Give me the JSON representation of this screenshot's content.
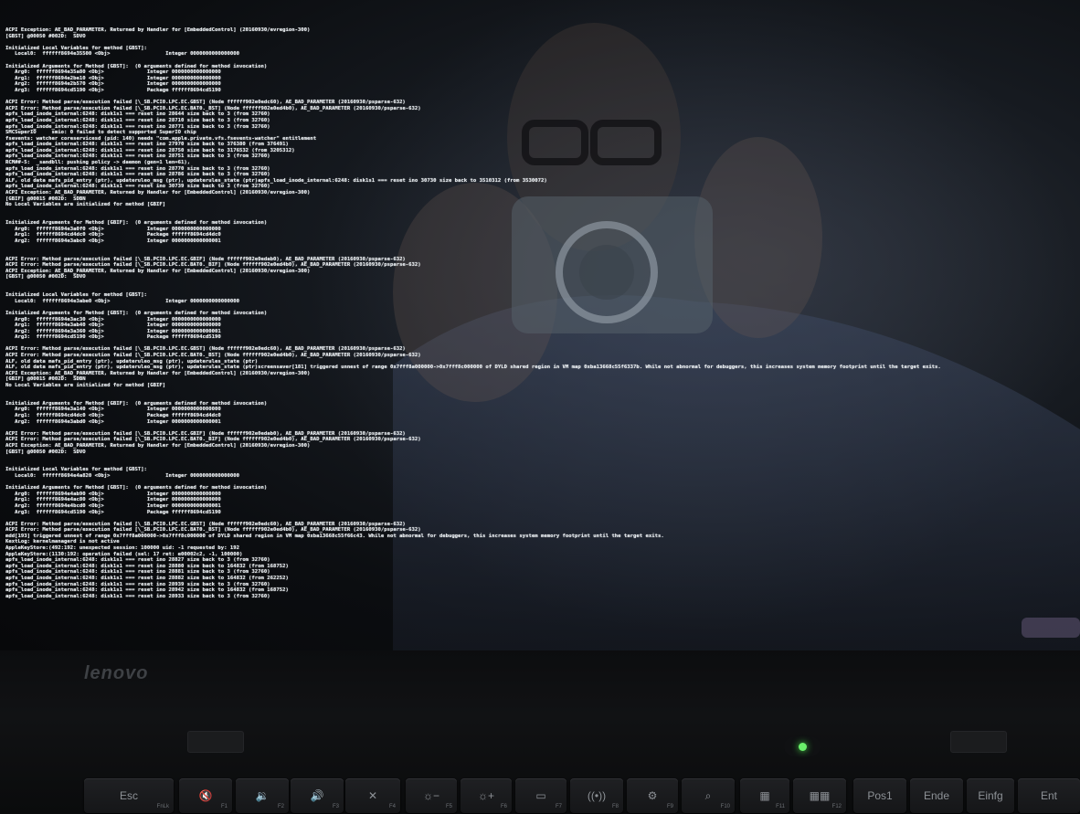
{
  "console": {
    "lines": [
      "ACPI Exception: AE_BAD_PARAMETER, Returned by Handler for [EmbeddedControl] (20160930/evregion-300)",
      "[GBST] @00050 #002D:  SDVO",
      "",
      "Initialized Local Variables for method [GBST]:",
      "   Local0:  ffffff8694e35500 <Obj>                  Integer 0000000000000000",
      "",
      "Initialized Arguments for Method [GBST]:  (0 arguments defined for method invocation)",
      "   Arg0:  ffffff8694e35a80 <Obj>              Integer 0000000000000000",
      "   Arg1:  ffffff8694e2be10 <Obj>              Integer 0000000000000000",
      "   Arg2:  ffffff8694e2b570 <Obj>              Integer 0000000000000000",
      "   Arg3:  ffffff8694cd5190 <Obj>              Package ffffff8694cd5190",
      "",
      "ACPI Error: Method parse/execution failed [\\_SB.PCI0.LPC.EC.GBST] (Node ffffff902e0edc60), AE_BAD_PARAMETER (20160930/psparse-632)",
      "ACPI Error: Method parse/execution failed [\\_SB.PCI0.LPC.EC.BAT0._BST] (Node ffffff902e0ed4b0), AE_BAD_PARAMETER (20160930/psparse-632)",
      "apfs_load_inode_internal:6248: disk1s1 === reset ino 28644 size back to 3 (from 32760)",
      "apfs_load_inode_internal:6248: disk1s1 === reset ino 28710 size back to 3 (from 32760)",
      "apfs_load_inode_internal:6248: disk1s1 === reset ino 28771 size back to 3 (from 32760)",
      "SMCSuperIO     smio: 0 failed to detect supported SuperIO chip",
      "fsevents: watcher coreservicesd (pid: 140) needs \"com.apple.private.vfs.fsevents-watcher\" entitlement",
      "apfs_load_inode_internal:6248: disk1s1 === reset ino 27970 size back to 376380 (from 376491)",
      "apfs_load_inode_internal:6248: disk1s1 === reset ino 28750 size back to 3176532 (from 3205312)",
      "apfs_load_inode_internal:6248: disk1s1 === reset ino 28751 size back to 3 (from 32760)",
      "RCM##-5:  _sandbll: pushing policy -> daemon (gen=1 len=61),",
      "apfs_load_inode_internal:6248: disk1s1 === reset ino 28770 size back to 3 (from 32760)",
      "apfs_load_inode_internal:6248: disk1s1 === reset ino 28786 size back to 3 (from 32760)",
      "ALF, old data mafs_pid_entry (ptr), updateruleo_msg (ptr), updaterules_state (ptr)apfs_load_inode_internal:6248: disk1s1 === reset ino 30730 size back to 3510312 (from 3530072)",
      "apfs_load_inode_internal:6248: disk1s1 === reset ino 30739 size back to 3 (from 32760)",
      "ACPI Exception: AE_BAD_PARAMETER, Returned by Handler for [EmbeddedControl] (20160930/evregion-300)",
      "[GBIF] @00015 #002D:  SDBN",
      "No Local Variables are initialized for method [GBIF]",
      "",
      "",
      "Initialized Arguments for Method [GBIF]:  (0 arguments defined for method invocation)",
      "   Arg0:  ffffff8694e3a0f0 <Obj>              Integer 0000000000000000",
      "   Arg1:  ffffff8694cd4dc0 <Obj>              Package ffffff8694cd4dc0",
      "   Arg2:  ffffff8694e3abc0 <Obj>              Integer 0000000000000001",
      "",
      "",
      "ACPI Error: Method parse/execution failed [\\_SB.PCI0.LPC.EC.GBIF] (Node ffffff902e0edab0), AE_BAD_PARAMETER (20160930/psparse-632)",
      "ACPI Error: Method parse/execution failed [\\_SB.PCI0.LPC.EC.BAT0._BIF] (Node ffffff902e0ed4b0), AE_BAD_PARAMETER (20160930/psparse-632)",
      "ACPI Exception: AE_BAD_PARAMETER, Returned by Handler for [EmbeddedControl] (20160930/evregion-300)",
      "[GBST] @00050 #002D:  SDVO",
      "",
      "",
      "Initialized Local Variables for method [GBST]:",
      "   Local0:  ffffff8694e3abe0 <Obj>                  Integer 0000000000000000",
      "",
      "Initialized Arguments for Method [GBST]:  (0 arguments defined for method invocation)",
      "   Arg0:  ffffff8694e3ac30 <Obj>              Integer 0000000000000000",
      "   Arg1:  ffffff8694e3ab40 <Obj>              Integer 0000000000000000",
      "   Arg2:  ffffff8694e3a360 <Obj>              Integer 0000000000000001",
      "   Arg3:  ffffff8694cd5190 <Obj>              Package ffffff8694cd5190",
      "",
      "ACPI Error: Method parse/execution failed [\\_SB.PCI0.LPC.EC.GBST] (Node ffffff902e0edc60), AE_BAD_PARAMETER (20160930/psparse-632)",
      "ACPI Error: Method parse/execution failed [\\_SB.PCI0.LPC.EC.BAT0._BST] (Node ffffff902e0ed4b0), AE_BAD_PARAMETER (20160930/psparse-632)",
      "ALF, old data mafs_pid_entry (ptr), updateruleo_msg (ptr), updaterules_state (ptr)",
      "ALF, old data mafs_pid_entry (ptr), updateruleo_msg (ptr), updaterules_state (ptr)screensaver[181] triggered unnest of range 0x7fff8a000000->0x7fff8c000000 of DYLD shared region in VM map 0xba13668c55f6337b. While not abnormal for debuggers, this increases system memory footprint until the target exits.",
      "ACPI Exception: AE_BAD_PARAMETER, Returned by Handler for [EmbeddedControl] (20160930/evregion-300)",
      "[GBIF] @00015 #002D:  SDBN",
      "No Local Variables are initialized for method [GBIF]",
      "",
      "",
      "Initialized Arguments for Method [GBIF]:  (0 arguments defined for method invocation)",
      "   Arg0:  ffffff8694e3a140 <Obj>              Integer 0000000000000000",
      "   Arg1:  ffffff8694cd4dc0 <Obj>              Package ffffff8694cd4dc0",
      "   Arg2:  ffffff8694e3abd0 <Obj>              Integer 0000000000000001",
      "",
      "ACPI Error: Method parse/execution failed [\\_SB.PCI0.LPC.EC.GBIF] (Node ffffff902e0edab0), AE_BAD_PARAMETER (20160930/psparse-632)",
      "ACPI Error: Method parse/execution failed [\\_SB.PCI0.LPC.EC.BAT0._BIF] (Node ffffff902e0ed4b0), AE_BAD_PARAMETER (20160930/psparse-632)",
      "ACPI Exception: AE_BAD_PARAMETER, Returned by Handler for [EmbeddedControl] (20160930/evregion-300)",
      "[GBST] @00050 #002D:  SDVO",
      "",
      "",
      "Initialized Local Variables for method [GBST]:",
      "   Local0:  ffffff8694e4a820 <Obj>                  Integer 0000000000000000",
      "",
      "Initialized Arguments for Method [GBST]:  (0 arguments defined for method invocation)",
      "   Arg0:  ffffff8694e4ab90 <Obj>              Integer 0000000000000000",
      "   Arg1:  ffffff8694e4ac80 <Obj>              Integer 0000000000000000",
      "   Arg2:  ffffff8694e4bcd0 <Obj>              Integer 0000000000000001",
      "   Arg3:  ffffff8694cd5190 <Obj>              Package ffffff8694cd5190",
      "",
      "ACPI Error: Method parse/execution failed [\\_SB.PCI0.LPC.EC.GBST] (Node ffffff902e0edc60), AE_BAD_PARAMETER (20160930/psparse-632)",
      "ACPI Error: Method parse/execution failed [\\_SB.PCI0.LPC.EC.BAT0._BST] (Node ffffff902e0ed4b0), AE_BAD_PARAMETER (20160930/psparse-632)",
      "mdd[193] triggered unnest of range 0x7fff8a000000->0x7fff8c000000 of DYLD shared region in VM map 0xba13668c55f66c43. While not abnormal for debuggers, this increases system memory footprint until the target exits.",
      "KextLog: kernelmanagerd is not active",
      "AppleKeyStore:(492:192: unexpected session: 100000 uid: -1 requested by: 192",
      "AppleKeyStore:(1130:192: operation failed (sel: 17 ret: e00002c2, -1, 100000)",
      "apfs_load_inode_internal:6248: disk1s1 === reset ino 28827 size back to 3 (from 32760)",
      "apfs_load_inode_internal:6248: disk1s1 === reset ino 28880 size back to 164832 (from 168752)",
      "apfs_load_inode_internal:6248: disk1s1 === reset ino 28881 size back to 3 (from 32760)",
      "apfs_load_inode_internal:6248: disk1s1 === reset ino 28882 size back to 164832 (from 262252)",
      "apfs_load_inode_internal:6248: disk1s1 === reset ino 28939 size back to 3 (from 32760)",
      "apfs_load_inode_internal:6248: disk1s1 === reset ino 28942 size back to 164832 (from 168752)",
      "apfs_load_inode_internal:6248: disk1s1 === reset ino 28933 size back to 3 (from 32760)"
    ]
  },
  "bezel": {
    "brand": "lenovo"
  },
  "keyboard": {
    "keys": [
      {
        "label": "Esc",
        "sub": "FnLk",
        "icon": "esc-key"
      },
      {
        "label": "🔇",
        "sub": "F1",
        "icon": "mute-icon"
      },
      {
        "label": "🔉",
        "sub": "F2",
        "icon": "volume-down-icon"
      },
      {
        "label": "🔊",
        "sub": "F3",
        "icon": "volume-up-icon"
      },
      {
        "label": "✕",
        "sub": "F4",
        "icon": "mic-mute-icon"
      },
      {
        "label": "☼−",
        "sub": "F5",
        "icon": "brightness-down-icon"
      },
      {
        "label": "☼+",
        "sub": "F6",
        "icon": "brightness-up-icon"
      },
      {
        "label": "▭",
        "sub": "F7",
        "icon": "display-icon"
      },
      {
        "label": "((•))",
        "sub": "F8",
        "icon": "wireless-icon"
      },
      {
        "label": "⚙",
        "sub": "F9",
        "icon": "settings-icon"
      },
      {
        "label": "⌕",
        "sub": "F10",
        "icon": "search-icon"
      },
      {
        "label": "▦",
        "sub": "F11",
        "icon": "window-icon"
      },
      {
        "label": "▦▦",
        "sub": "F12",
        "icon": "apps-icon"
      },
      {
        "label": "Pos1",
        "sub": "",
        "icon": "home-key"
      },
      {
        "label": "Ende",
        "sub": "",
        "icon": "end-key"
      },
      {
        "label": "Einfg",
        "sub": "",
        "icon": "insert-key"
      },
      {
        "label": "Ent",
        "sub": "",
        "icon": "delete-key"
      }
    ]
  },
  "colors": {
    "console_text": "#e9eef2",
    "power_led": "#6af06a"
  }
}
